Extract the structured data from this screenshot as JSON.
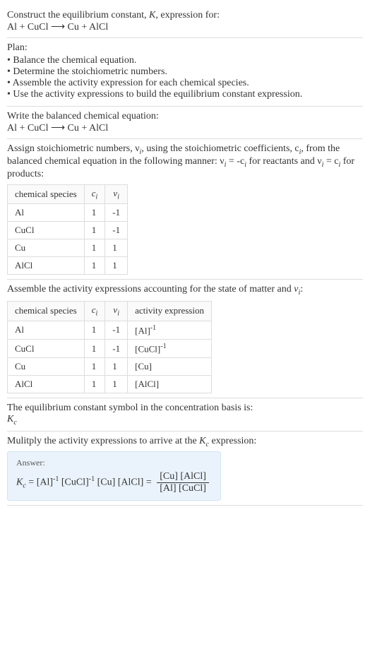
{
  "intro": {
    "line1": "Construct the equilibrium constant, K, expression for:",
    "eq": "Al + CuCl ⟶ Cu + AlCl"
  },
  "plan": {
    "title": "Plan:",
    "items": [
      "Balance the chemical equation.",
      "Determine the stoichiometric numbers.",
      "Assemble the activity expression for each chemical species.",
      "Use the activity expressions to build the equilibrium constant expression."
    ]
  },
  "balanced": {
    "title": "Write the balanced chemical equation:",
    "eq": "Al + CuCl ⟶ Cu + AlCl"
  },
  "stoich": {
    "text_a": "Assign stoichiometric numbers, ν",
    "text_b": ", using the stoichiometric coefficients, c",
    "text_c": ", from the balanced chemical equation in the following manner: ν",
    "text_d": " = -c",
    "text_e": " for reactants and ν",
    "text_f": " = c",
    "text_g": " for products:",
    "headers": [
      "chemical species",
      "cᵢ",
      "νᵢ"
    ],
    "rows": [
      [
        "Al",
        "1",
        "-1"
      ],
      [
        "CuCl",
        "1",
        "-1"
      ],
      [
        "Cu",
        "1",
        "1"
      ],
      [
        "AlCl",
        "1",
        "1"
      ]
    ]
  },
  "activity": {
    "title": "Assemble the activity expressions accounting for the state of matter and νᵢ:",
    "headers": [
      "chemical species",
      "cᵢ",
      "νᵢ",
      "activity expression"
    ],
    "rows": [
      [
        "Al",
        "1",
        "-1",
        "[Al]⁻¹"
      ],
      [
        "CuCl",
        "1",
        "-1",
        "[CuCl]⁻¹"
      ],
      [
        "Cu",
        "1",
        "1",
        "[Cu]"
      ],
      [
        "AlCl",
        "1",
        "1",
        "[AlCl]"
      ]
    ]
  },
  "symbol": {
    "line1": "The equilibrium constant symbol in the concentration basis is:",
    "line2": "K_c"
  },
  "multiply": {
    "title": "Mulitply the activity expressions to arrive at the K_c expression:"
  },
  "answer": {
    "label": "Answer:",
    "lhs": "K_c = [Al]⁻¹ [CuCl]⁻¹ [Cu] [AlCl] = ",
    "num": "[Cu] [AlCl]",
    "den": "[Al] [CuCl]"
  },
  "chart_data": {
    "type": "table",
    "tables": [
      {
        "title": "Stoichiometric numbers",
        "columns": [
          "chemical species",
          "c_i",
          "nu_i"
        ],
        "rows": [
          {
            "chemical species": "Al",
            "c_i": 1,
            "nu_i": -1
          },
          {
            "chemical species": "CuCl",
            "c_i": 1,
            "nu_i": -1
          },
          {
            "chemical species": "Cu",
            "c_i": 1,
            "nu_i": 1
          },
          {
            "chemical species": "AlCl",
            "c_i": 1,
            "nu_i": 1
          }
        ]
      },
      {
        "title": "Activity expressions",
        "columns": [
          "chemical species",
          "c_i",
          "nu_i",
          "activity expression"
        ],
        "rows": [
          {
            "chemical species": "Al",
            "c_i": 1,
            "nu_i": -1,
            "activity expression": "[Al]^-1"
          },
          {
            "chemical species": "CuCl",
            "c_i": 1,
            "nu_i": -1,
            "activity expression": "[CuCl]^-1"
          },
          {
            "chemical species": "Cu",
            "c_i": 1,
            "nu_i": 1,
            "activity expression": "[Cu]"
          },
          {
            "chemical species": "AlCl",
            "c_i": 1,
            "nu_i": 1,
            "activity expression": "[AlCl]"
          }
        ]
      }
    ]
  }
}
